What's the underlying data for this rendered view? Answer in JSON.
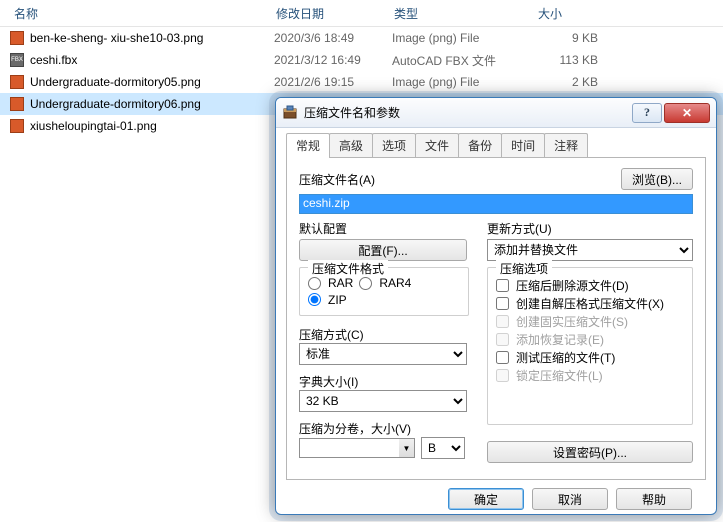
{
  "filelist": {
    "headers": {
      "name": "名称",
      "date": "修改日期",
      "type": "类型",
      "size": "大小"
    },
    "rows": [
      {
        "name": "ben-ke-sheng- xiu-she10-03.png",
        "date": "2020/3/6 18:49",
        "type": "Image (png) File",
        "size": "9 KB",
        "kind": "png",
        "sel": false
      },
      {
        "name": "ceshi.fbx",
        "date": "2021/3/12 16:49",
        "type": "AutoCAD FBX 文件",
        "size": "113 KB",
        "kind": "fbx",
        "sel": false
      },
      {
        "name": "Undergraduate-dormitory05.png",
        "date": "2021/2/6 19:15",
        "type": "Image (png) File",
        "size": "2 KB",
        "kind": "png",
        "sel": false
      },
      {
        "name": "Undergraduate-dormitory06.png",
        "date": "",
        "type": "",
        "size": "",
        "kind": "png",
        "sel": true
      },
      {
        "name": "xiusheloupingtai-01.png",
        "date": "",
        "type": "",
        "size": "",
        "kind": "png",
        "sel": false
      }
    ]
  },
  "dialog": {
    "title": "压缩文件名和参数",
    "tabs": [
      "常规",
      "高级",
      "选项",
      "文件",
      "备份",
      "时间",
      "注释"
    ],
    "filename_label": "压缩文件名(A)",
    "filename_value": "ceshi.zip",
    "browse_btn": "浏览(B)...",
    "profile_label": "默认配置",
    "profile_btn": "配置(F)...",
    "update_label": "更新方式(U)",
    "update_value": "添加并替换文件",
    "format_group": "压缩文件格式",
    "format_options": [
      "RAR",
      "RAR4",
      "ZIP"
    ],
    "format_selected": "ZIP",
    "options_group": "压缩选项",
    "options": [
      {
        "label": "压缩后删除源文件(D)",
        "checked": false,
        "disabled": false
      },
      {
        "label": "创建自解压格式压缩文件(X)",
        "checked": false,
        "disabled": false
      },
      {
        "label": "创建固实压缩文件(S)",
        "checked": false,
        "disabled": true
      },
      {
        "label": "添加恢复记录(E)",
        "checked": false,
        "disabled": true
      },
      {
        "label": "测试压缩的文件(T)",
        "checked": false,
        "disabled": false
      },
      {
        "label": "锁定压缩文件(L)",
        "checked": false,
        "disabled": true
      }
    ],
    "method_label": "压缩方式(C)",
    "method_value": "标准",
    "dict_label": "字典大小(I)",
    "dict_value": "32 KB",
    "split_label": "压缩为分卷，大小(V)",
    "split_unit": "B",
    "password_btn": "设置密码(P)...",
    "footer": {
      "ok": "确定",
      "cancel": "取消",
      "help": "帮助"
    }
  }
}
